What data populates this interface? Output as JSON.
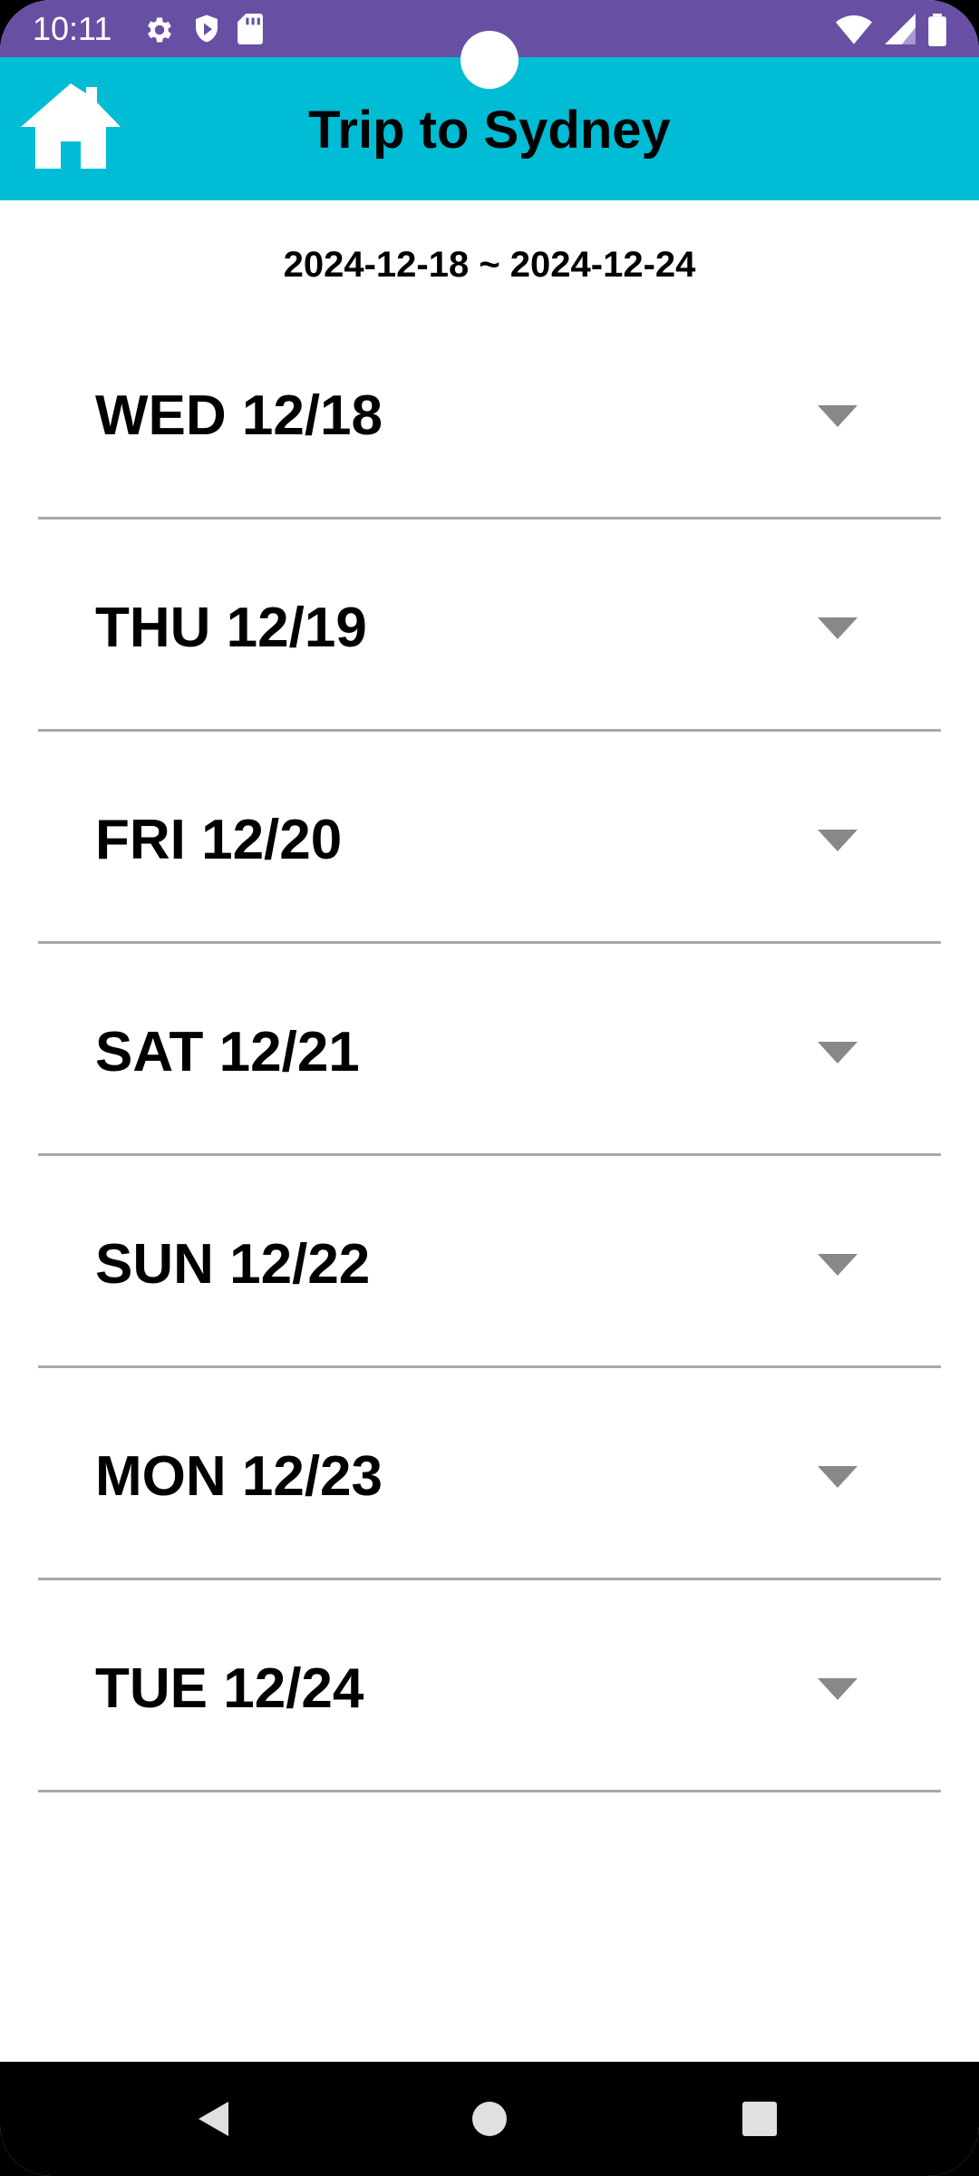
{
  "status_bar": {
    "time": "10:11",
    "left_icons": [
      "settings-icon",
      "shield-play-icon",
      "sd-card-icon"
    ],
    "right_icons": [
      "wifi-icon",
      "cell-signal-icon",
      "battery-icon"
    ],
    "color": "#6750a4"
  },
  "app_bar": {
    "title": "Trip to Sydney",
    "home_icon": "home-icon",
    "color": "#00bcd4"
  },
  "trip": {
    "date_range": "2024-12-18 ~ 2024-12-24"
  },
  "days": [
    {
      "label": "WED 12/18"
    },
    {
      "label": "THU 12/19"
    },
    {
      "label": "FRI 12/20"
    },
    {
      "label": "SAT 12/21"
    },
    {
      "label": "SUN 12/22"
    },
    {
      "label": "MON 12/23"
    },
    {
      "label": "TUE 12/24"
    }
  ],
  "navigation_bar": {
    "buttons": [
      "back-icon",
      "home-circle-icon",
      "recents-icon"
    ]
  }
}
